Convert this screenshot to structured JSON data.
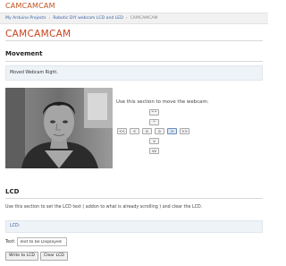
{
  "site": {
    "title": "CAMCAMCAM"
  },
  "breadcrumb": [
    {
      "label": "My Arduino Projects"
    },
    {
      "label": "Robotic DIY webcam LCD and LED"
    },
    {
      "label": "CAMCAMCAM"
    }
  ],
  "page": {
    "title": "CAMCAMCAM"
  },
  "movement": {
    "heading": "Movement",
    "status": "Moved Webcam Right.",
    "instruction": "Use this section to move the webcam:",
    "controls": {
      "up_fast": "^^",
      "up": "^",
      "left_fast": "<<",
      "left": "<",
      "center": "o",
      "right": ">",
      "right_fast": ">>",
      "down": "v",
      "down_fast": "vv",
      "active": "right"
    }
  },
  "lcd": {
    "heading": "LCD",
    "description": "Use this section to set the LCD text ( addon to what is already scrolling ) and clear the LCD.",
    "display_label": "LCD:",
    "text_label": "Text:",
    "text_value": "Text to be Displayed",
    "write_button": "Write to LCD",
    "clear_button": "Clear LCD"
  },
  "colors": {
    "accent": "#c9421c",
    "link": "#3b63a8",
    "notice_bg": "#eef3f8"
  }
}
